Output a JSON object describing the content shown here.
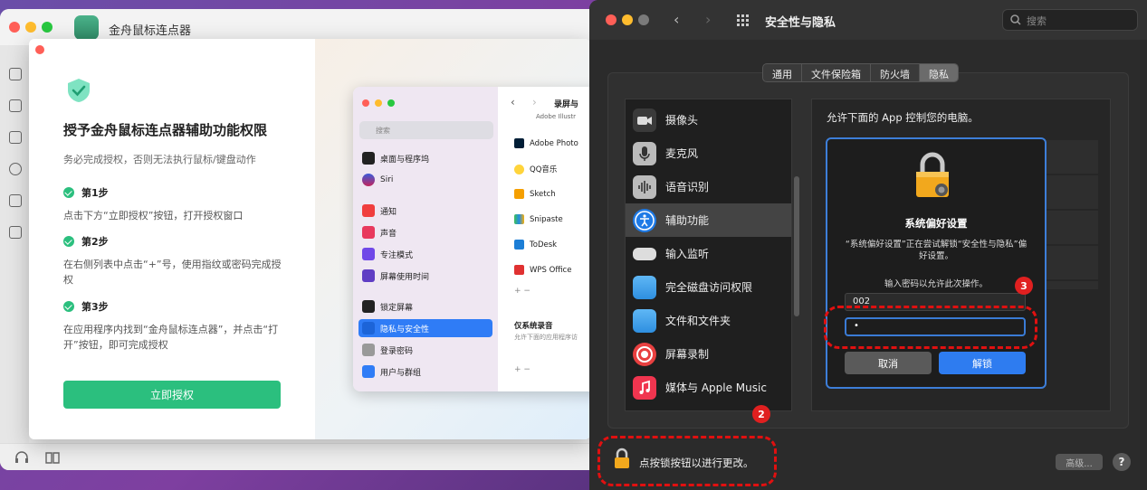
{
  "left_window": {
    "app_title": "金舟鼠标连点器"
  },
  "modal": {
    "title": "授予金舟鼠标连点器辅助功能权限",
    "subtitle": "务必完成授权，否则无法执行鼠标/键盘动作",
    "steps": [
      {
        "label": "第1步",
        "desc": "点击下方“立即授权”按钮，打开授权窗口"
      },
      {
        "label": "第2步",
        "desc": "在右侧列表中点击“+”号，使用指纹或密码完成授权"
      },
      {
        "label": "第3步",
        "desc": "在应用程序内找到“金舟鼠标连点器”，并点击“打开”按钮，即可完成授权"
      }
    ],
    "button": "立即授权"
  },
  "preview": {
    "search_placeholder": "搜索",
    "header": "录屏与",
    "sidebar_items": [
      "桌面与程序坞",
      "Siri",
      "通知",
      "声音",
      "专注模式",
      "屏幕使用时间",
      "锁定屏幕",
      "隐私与安全性",
      "登录密码",
      "用户与群组"
    ],
    "app_items": [
      "Adobe Photo",
      "QQ音乐",
      "Sketch",
      "Snipaste",
      "ToDesk",
      "WPS Office"
    ],
    "top_cut_item": "Adobe Illustr",
    "section_title": "仅系统录音",
    "section_desc": "允许下面的应用程序访",
    "add_remove": "+ −"
  },
  "prefs": {
    "title": "安全性与隐私",
    "search_placeholder": "搜索",
    "tabs": [
      "通用",
      "文件保险箱",
      "防火墙",
      "隐私"
    ],
    "active_tab": "隐私",
    "list": [
      "摄像头",
      "麦克风",
      "语音识别",
      "辅助功能",
      "输入监听",
      "完全磁盘访问权限",
      "文件和文件夹",
      "屏幕录制",
      "媒体与 Apple Music"
    ],
    "selected": "辅助功能",
    "right_text": "允许下面的 App 控制您的电脑。",
    "lock_text": "点按锁按钮以进行更改。",
    "advanced": "高级...",
    "help": "?"
  },
  "auth_dialog": {
    "title": "系统偏好设置",
    "desc": "“系统偏好设置”正在尝试解锁“安全性与隐私”偏好设置。",
    "prompt": "输入密码以允许此次操作。",
    "username": "002",
    "password_mask": "•",
    "cancel": "取消",
    "unlock": "解锁"
  },
  "annotations": {
    "badge_2": "2",
    "badge_3": "3"
  },
  "colors": {
    "accent_green": "#2bbf7e",
    "accent_blue": "#2e7cf0",
    "annotation_red": "#e01010"
  }
}
